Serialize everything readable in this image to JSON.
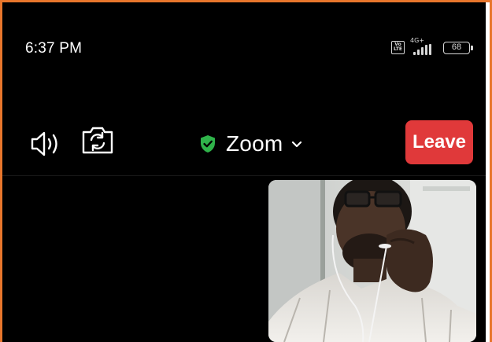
{
  "status_bar": {
    "time": "6:37 PM",
    "volte_badge": "Vo LTE",
    "network_type": "4G+",
    "signal_icon": "signal-bars-icon",
    "battery_level": "68"
  },
  "toolbar": {
    "speaker_icon": "speaker-icon",
    "switch_camera_icon": "switch-camera-icon",
    "security_icon": "shield-check-icon",
    "security_color": "#2fb34a",
    "meeting_title": "Zoom",
    "title_dropdown_icon": "chevron-down-icon",
    "leave_label": "Leave",
    "leave_color": "#e0393a"
  },
  "video": {
    "participant_thumbnail": "self-video-thumbnail"
  }
}
